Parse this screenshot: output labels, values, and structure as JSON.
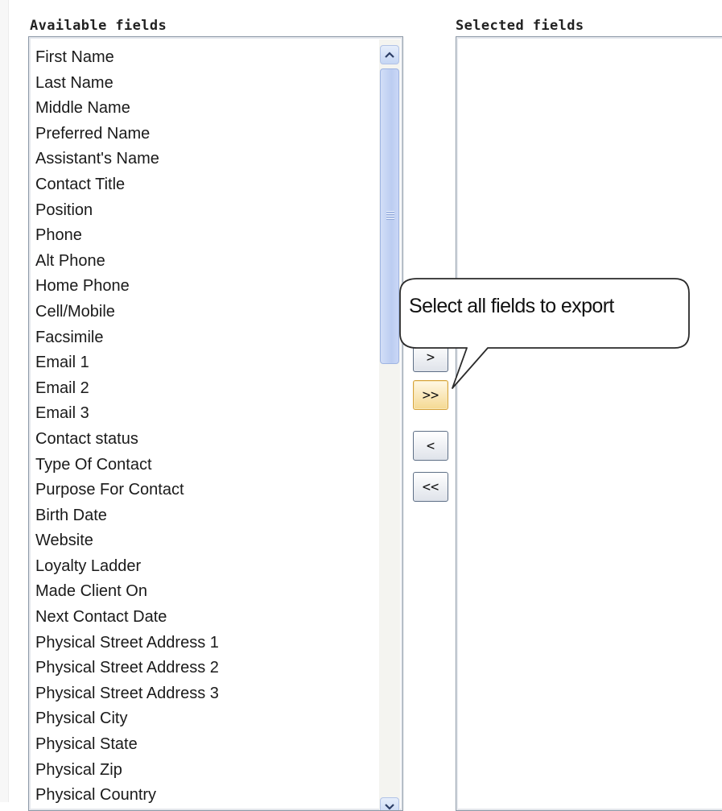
{
  "available": {
    "heading": "Available fields",
    "items": [
      "First Name",
      "Last Name",
      "Middle Name",
      "Preferred Name",
      "Assistant's Name",
      "Contact Title",
      "Position",
      "Phone",
      "Alt Phone",
      "Home Phone",
      "Cell/Mobile",
      "Facsimile",
      "Email 1",
      "Email 2",
      "Email 3",
      "Contact status",
      "Type Of Contact",
      "Purpose For Contact",
      "Birth Date",
      "Website",
      "Loyalty Ladder",
      "Made Client On",
      "Next Contact Date",
      "Physical Street Address 1",
      "Physical Street Address 2",
      "Physical Street Address 3",
      "Physical City",
      "Physical State",
      "Physical Zip",
      "Physical Country"
    ]
  },
  "selected": {
    "heading": "Selected fields",
    "items": []
  },
  "buttons": {
    "add_one": ">",
    "add_all": ">>",
    "remove_one": "<",
    "remove_all": "<<"
  },
  "callout": {
    "text": "Select all fields to export"
  },
  "colors": {
    "highlight_button": "#f5d992",
    "scroll_thumb": "#c5d6f4",
    "listbox_border": "#8e9aa8"
  }
}
